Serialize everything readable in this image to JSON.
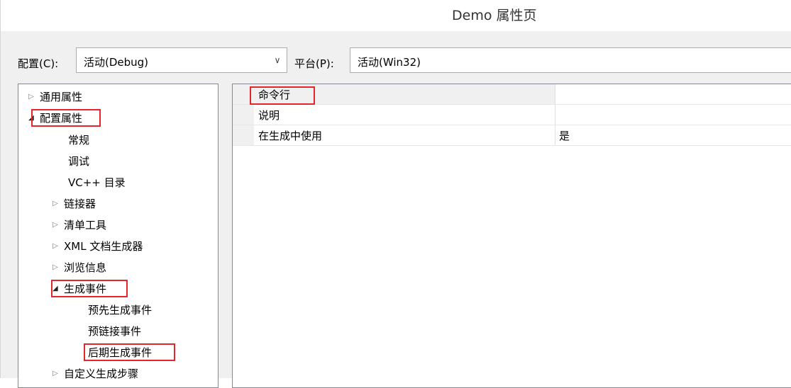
{
  "window": {
    "title": "Demo 属性页"
  },
  "config_bar": {
    "config_label": "配置(C):",
    "config_value": "活动(Debug)",
    "platform_label": "平台(P):",
    "platform_value": "活动(Win32)"
  },
  "tree": {
    "items": [
      {
        "label": "通用属性",
        "toggle": "collapsed"
      },
      {
        "label": "配置属性",
        "toggle": "expanded",
        "highlighted": true
      },
      {
        "label": "常规",
        "toggle": "none"
      },
      {
        "label": "调试",
        "toggle": "none"
      },
      {
        "label": "VC++ 目录",
        "toggle": "none"
      },
      {
        "label": "链接器",
        "toggle": "collapsed"
      },
      {
        "label": "清单工具",
        "toggle": "collapsed"
      },
      {
        "label": "XML 文档生成器",
        "toggle": "collapsed"
      },
      {
        "label": "浏览信息",
        "toggle": "collapsed"
      },
      {
        "label": "生成事件",
        "toggle": "expanded",
        "highlighted": true
      },
      {
        "label": "预先生成事件",
        "toggle": "none"
      },
      {
        "label": "预链接事件",
        "toggle": "none"
      },
      {
        "label": "后期生成事件",
        "toggle": "none",
        "highlighted": true,
        "selected": true
      },
      {
        "label": "自定义生成步骤",
        "toggle": "collapsed"
      }
    ]
  },
  "grid": {
    "rows": [
      {
        "name": "命令行",
        "value": "",
        "highlighted": true
      },
      {
        "name": "说明",
        "value": ""
      },
      {
        "name": "在生成中使用",
        "value": "是"
      }
    ]
  },
  "colors": {
    "highlight_border": "#e3262e",
    "panel_border": "#828790",
    "background": "#f0f0f0"
  },
  "icons": {
    "collapsed": "triangle-right-outline-icon",
    "expanded": "triangle-down-filled-icon",
    "dropdown": "chevron-down-icon"
  }
}
